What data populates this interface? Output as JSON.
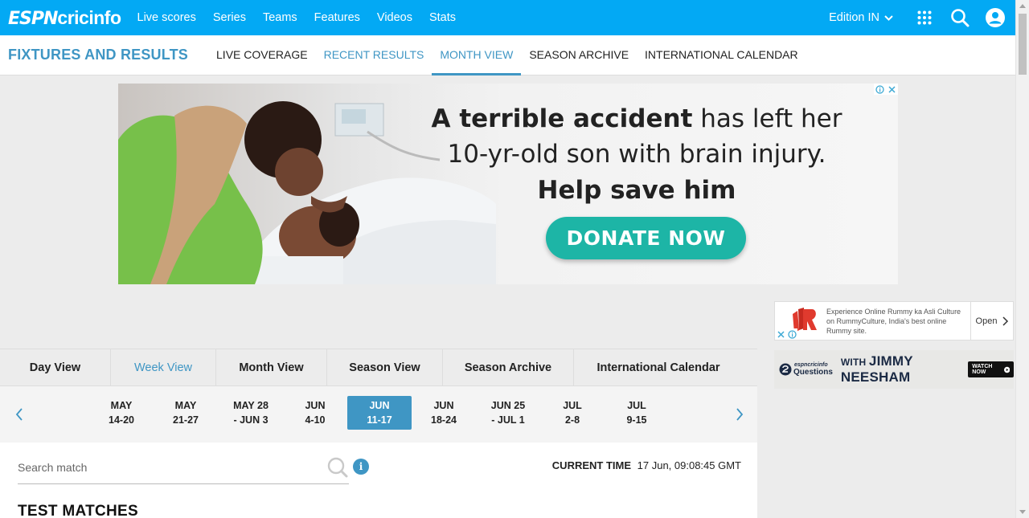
{
  "header": {
    "logo_espn": "ESPN",
    "logo_cric": "cricinfo",
    "nav": [
      "Live scores",
      "Series",
      "Teams",
      "Features",
      "Videos",
      "Stats"
    ],
    "edition": "Edition IN",
    "icons": [
      "apps-grid-icon",
      "search-icon",
      "user-account-icon"
    ],
    "bg_color": "#03a9f4"
  },
  "subnav": {
    "title": "FIXTURES AND RESULTS",
    "tabs": [
      "LIVE COVERAGE",
      "RECENT RESULTS",
      "MONTH VIEW",
      "SEASON ARCHIVE",
      "INTERNATIONAL CALENDAR"
    ],
    "active_tabs": [
      "RECENT RESULTS",
      "MONTH VIEW"
    ],
    "accent_color": "#3f96c4"
  },
  "ad_main": {
    "line1_bold": "A terrible accident",
    "line1_rest": " has left her",
    "line2": "10-yr-old son with brain injury.",
    "line3": "Help save him",
    "cta": "DONATE NOW",
    "cta_color": "#1db5a6"
  },
  "ad_rummy": {
    "text": "Experience Online Rummy ka Asli Culture on RummyCulture, India's best online Rummy site.",
    "cta": "Open"
  },
  "ad_neesham": {
    "brand": "espncricinfo",
    "questions": "Questions",
    "with": "WITH",
    "name": "JIMMY NEESHAM",
    "cta": "WATCH NOW"
  },
  "view_tabs": [
    "Day View",
    "Week View",
    "Month View",
    "Season View",
    "Season Archive",
    "International Calendar"
  ],
  "active_view": "Week View",
  "weeks": [
    {
      "l1": "MAY",
      "l2": "14-20"
    },
    {
      "l1": "MAY",
      "l2": "21-27"
    },
    {
      "l1": "MAY 28",
      "l2": "- JUN 3"
    },
    {
      "l1": "JUN",
      "l2": "4-10"
    },
    {
      "l1": "JUN",
      "l2": "11-17"
    },
    {
      "l1": "JUN",
      "l2": "18-24"
    },
    {
      "l1": "JUN 25",
      "l2": "- JUL 1"
    },
    {
      "l1": "JUL",
      "l2": "2-8"
    },
    {
      "l1": "JUL",
      "l2": "9-15"
    }
  ],
  "active_week": "JUN 11-17",
  "search": {
    "placeholder": "Search match"
  },
  "current_time": {
    "label": "CURRENT TIME",
    "value": "17 Jun, 09:08:45  GMT"
  },
  "section_heading": "TEST MATCHES"
}
